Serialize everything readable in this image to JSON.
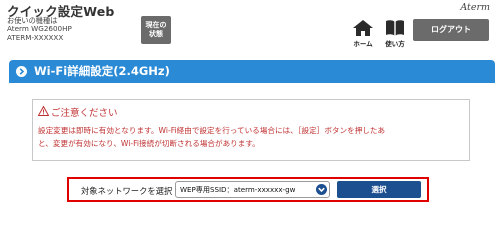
{
  "header": {
    "app_title": "クイック設定Web",
    "device_lines": [
      "お使いの機種は",
      "Aterm WG2600HP",
      "ATERM-XXXXXX"
    ],
    "status_button": [
      "現在の",
      "状態"
    ],
    "brand": "Aterm",
    "home_label": "ホーム",
    "manual_label": "使い方",
    "logout_label": "ログアウト"
  },
  "section": {
    "title": "Wi-Fi詳細設定(2.4GHz)"
  },
  "notice": {
    "title": "ご注意ください",
    "lines": [
      "設定変更は即時に有効となります。Wi-Fi経由で設定を行っている場合には、［設定］ボタンを押したあ",
      "と、変更が有効になり、Wi-Fi接続が切断される場合があります。"
    ]
  },
  "network_selection": {
    "label": "対象ネットワークを選択",
    "selected_value": "WEP専用SSID：aterm-xxxxxx-gw",
    "button_label": "選択"
  },
  "colors": {
    "section_bar": "#2a8ad6",
    "warning_red": "#c03232",
    "highlight_border": "#e00000",
    "select_button": "#1c4f8f",
    "dark_button": "#6b6b6b"
  },
  "icons": [
    "home-icon",
    "book-icon",
    "chevron-right-icon",
    "warning-icon",
    "chevron-down-icon"
  ]
}
